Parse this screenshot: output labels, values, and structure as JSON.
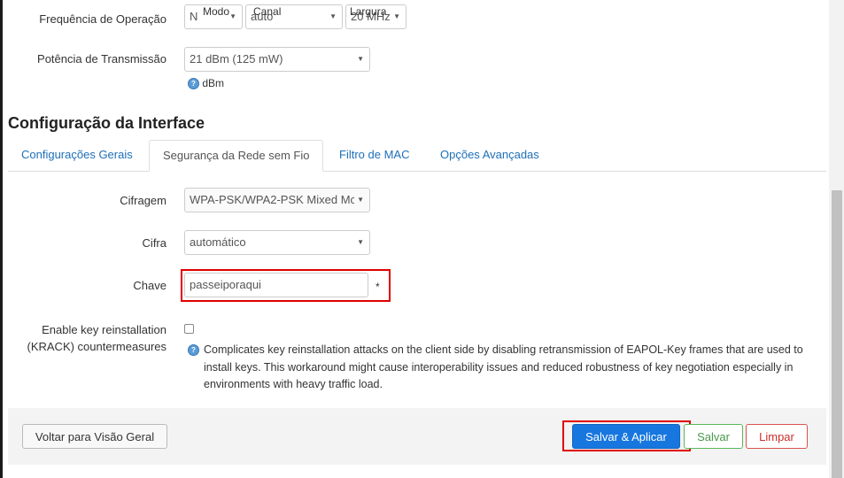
{
  "radio": {
    "mode_label": "Modo",
    "channel_label": "Canal",
    "width_label": "Largura",
    "frequency_label": "Frequência de Operação",
    "mode_value": "N",
    "channel_value": "auto",
    "width_value": "20 MHz",
    "tx_power_label": "Potência de Transmissão",
    "tx_power_value": "21 dBm (125 mW)",
    "tx_power_unit": "dBm"
  },
  "interface": {
    "title": "Configuração da Interface",
    "tabs": [
      {
        "label": "Configurações Gerais"
      },
      {
        "label": "Segurança da Rede sem Fio"
      },
      {
        "label": "Filtro de MAC"
      },
      {
        "label": "Opções Avançadas"
      }
    ],
    "active_tab": "Segurança da Rede sem Fio"
  },
  "security": {
    "encryption_label": "Cifragem",
    "encryption_value": "WPA-PSK/WPA2-PSK Mixed Mc",
    "cipher_label": "Cifra",
    "cipher_value": "automático",
    "key_label": "Chave",
    "key_value": "passeiporaqui",
    "key_reveal": "*",
    "krack_label_line1": "Enable key reinstallation",
    "krack_label_line2": "(KRACK) countermeasures",
    "krack_checked": false,
    "krack_help": "Complicates key reinstallation attacks on the client side by disabling retransmission of EAPOL-Key frames that are used to install keys. This workaround might cause interoperability issues and reduced robustness of key negotiation especially in environments with heavy traffic load."
  },
  "footer": {
    "back_label": "Voltar para Visão Geral",
    "save_apply_label": "Salvar & Aplicar",
    "save_label": "Salvar",
    "reset_label": "Limpar"
  },
  "icons": {
    "help": "help-icon",
    "dropdown": "chevron-down-icon"
  },
  "colors": {
    "link": "#1e6fb8",
    "primary": "#1777df",
    "success": "#5cb85c",
    "danger": "#d9534f",
    "highlight": "#e00000"
  }
}
